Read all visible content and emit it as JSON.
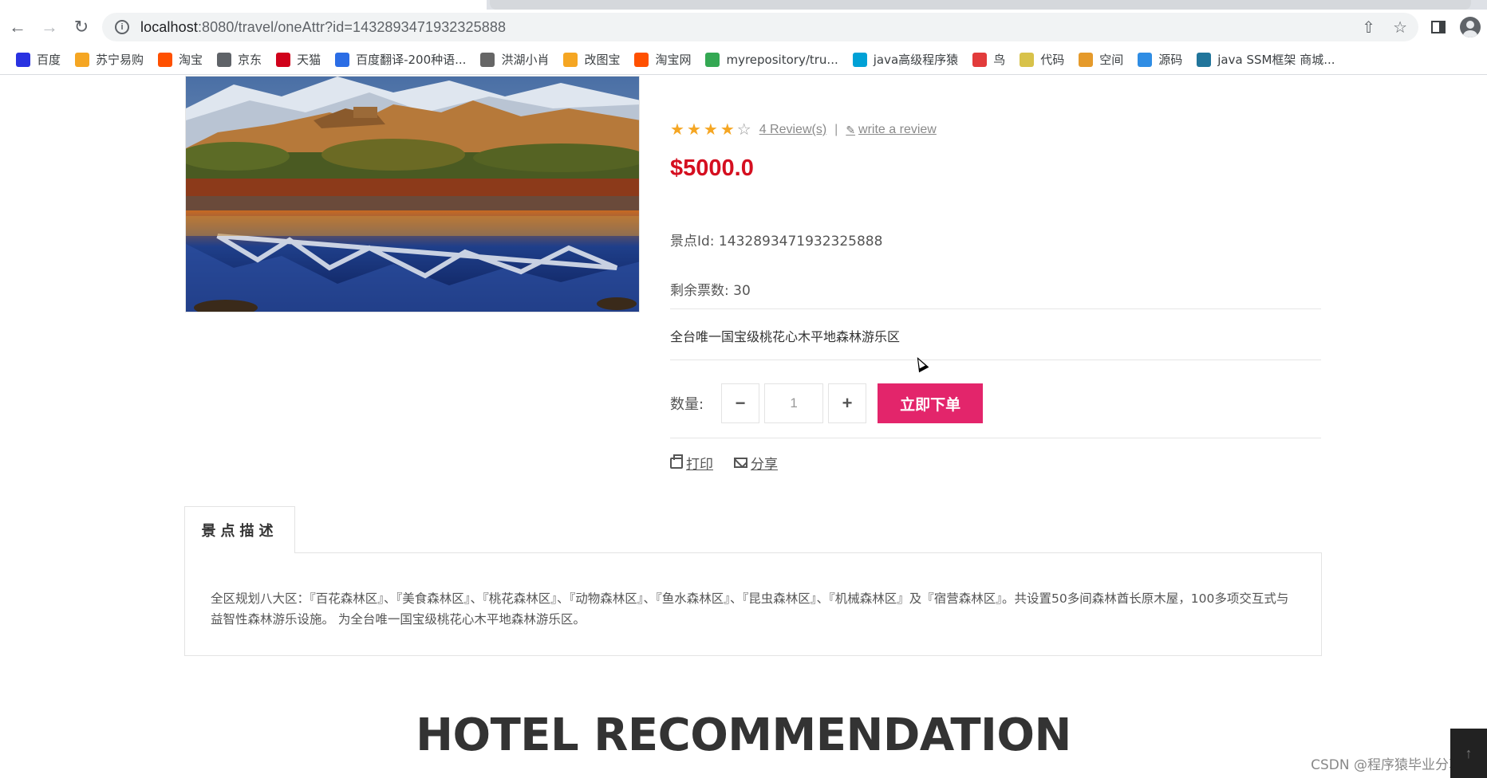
{
  "browser": {
    "url_host": "localhost",
    "url_path": ":8080/travel/oneAttr?id=1432893471932325888",
    "bookmarks": [
      {
        "label": "百度",
        "icon": "baidu-icon",
        "color": "#2932e1"
      },
      {
        "label": "苏宁易购",
        "icon": "suning-icon",
        "color": "#f5a623"
      },
      {
        "label": "淘宝",
        "icon": "taobao-icon",
        "color": "#ff5000"
      },
      {
        "label": "京东",
        "icon": "globe-icon",
        "color": "#5f6368"
      },
      {
        "label": "天猫",
        "icon": "tmall-icon",
        "color": "#d0021b"
      },
      {
        "label": "百度翻译-200种语...",
        "icon": "translate-icon",
        "color": "#2b6de5"
      },
      {
        "label": "洪湖小肖",
        "icon": "feather-icon",
        "color": "#666666"
      },
      {
        "label": "改图宝",
        "icon": "gaitubao-icon",
        "color": "#f5a623"
      },
      {
        "label": "淘宝网",
        "icon": "taobao-icon",
        "color": "#ff5000"
      },
      {
        "label": "myrepository/tru...",
        "icon": "chrome-icon",
        "color": "#34a853"
      },
      {
        "label": "java高级程序猿",
        "icon": "bilibili-icon",
        "color": "#00a1d6"
      },
      {
        "label": "鸟",
        "icon": "bird-icon",
        "color": "#e23b3b"
      },
      {
        "label": "代码",
        "icon": "code-icon",
        "color": "#d8c24a"
      },
      {
        "label": "空间",
        "icon": "space-icon",
        "color": "#e59a2b"
      },
      {
        "label": "源码",
        "icon": "source-icon",
        "color": "#2f8de4"
      },
      {
        "label": "java SSM框架 商城...",
        "icon": "wordpress-icon",
        "color": "#21759b"
      }
    ]
  },
  "product": {
    "rating": 4,
    "rating_max": 5,
    "reviews_link": "4 Review(s)",
    "separator": "|",
    "write_review": "write a review",
    "price": "$5000.0",
    "spot_id": "景点Id: 1432893471932325888",
    "tickets_left": "剩余票数: 30",
    "summary": "全台唯一国宝级桃花心木平地森林游乐区",
    "qty_label": "数量:",
    "qty_minus": "−",
    "qty_value": "1",
    "qty_plus": "+",
    "order_button": "立即下单",
    "print_label": "打印",
    "share_label": "分享"
  },
  "description": {
    "tab_label": "景点描述",
    "text": "全区规划八大区：『百花森林区』、『美食森林区』、『桃花森林区』、『动物森林区』、『鱼水森林区』、『昆虫森林区』、『机械森林区』及『宿营森林区』。共设置50多间森林酋长原木屋，100多项交互式与益智性森林游乐设施。 为全台唯一国宝级桃花心木平地森林游乐区。"
  },
  "hotel_heading": "HOTEL RECOMMENDATION",
  "watermark": "CSDN @程序猿毕业分享网",
  "colors": {
    "price": "#d50f20",
    "order_button": "#e3256b",
    "star": "#f5a623"
  }
}
